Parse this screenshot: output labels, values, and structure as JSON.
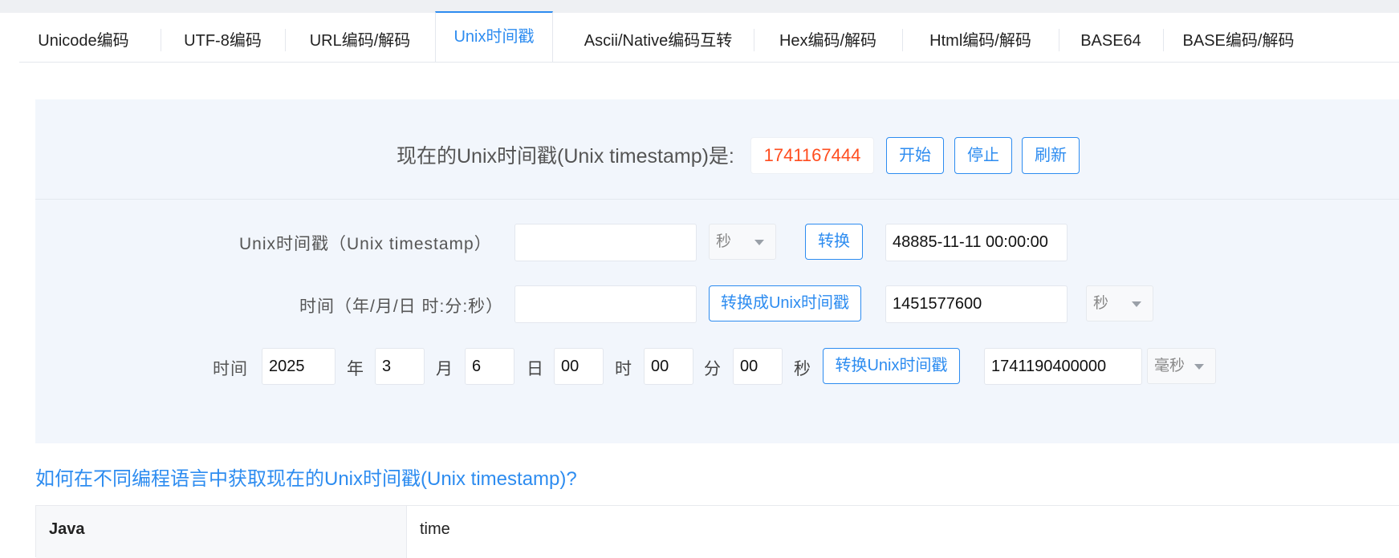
{
  "tabs": [
    {
      "label": "Unicode编码"
    },
    {
      "label": "UTF-8编码"
    },
    {
      "label": "URL编码/解码"
    },
    {
      "label": "Unix时间戳"
    },
    {
      "label": "Ascii/Native编码互转"
    },
    {
      "label": "Hex编码/解码"
    },
    {
      "label": "Html编码/解码"
    },
    {
      "label": "BASE64"
    },
    {
      "label": "BASE编码/解码"
    }
  ],
  "active_tab": "Unix时间戳",
  "now": {
    "label": "现在的Unix时间戳(Unix timestamp)是:",
    "value": "1741167444",
    "start_label": "开始",
    "stop_label": "停止",
    "refresh_label": "刷新"
  },
  "row1": {
    "label": "Unix时间戳（Unix timestamp）",
    "input_value": "",
    "unit_select": "秒",
    "convert_label": "转换",
    "result": "48885-11-11 00:00:00"
  },
  "row2": {
    "label": "时间（年/月/日 时:分:秒）",
    "input_value": "",
    "convert_label": "转换成Unix时间戳",
    "result": "1451577600",
    "unit_select": "秒"
  },
  "row3": {
    "label": "时间",
    "year": "2025",
    "year_unit": "年",
    "month": "3",
    "month_unit": "月",
    "day": "6",
    "day_unit": "日",
    "hour": "00",
    "hour_unit": "时",
    "minute": "00",
    "minute_unit": "分",
    "second": "00",
    "second_unit": "秒",
    "convert_label": "转换Unix时间戳",
    "result": "1741190400000",
    "unit_select": "毫秒"
  },
  "question": "如何在不同编程语言中获取现在的Unix时间戳(Unix timestamp)?",
  "table": [
    {
      "lang": "Java",
      "code": "time"
    }
  ],
  "colors": {
    "accent": "#2d8cf0",
    "timestamp": "#ff4d1f",
    "panel_bg": "#f2f6fc"
  }
}
